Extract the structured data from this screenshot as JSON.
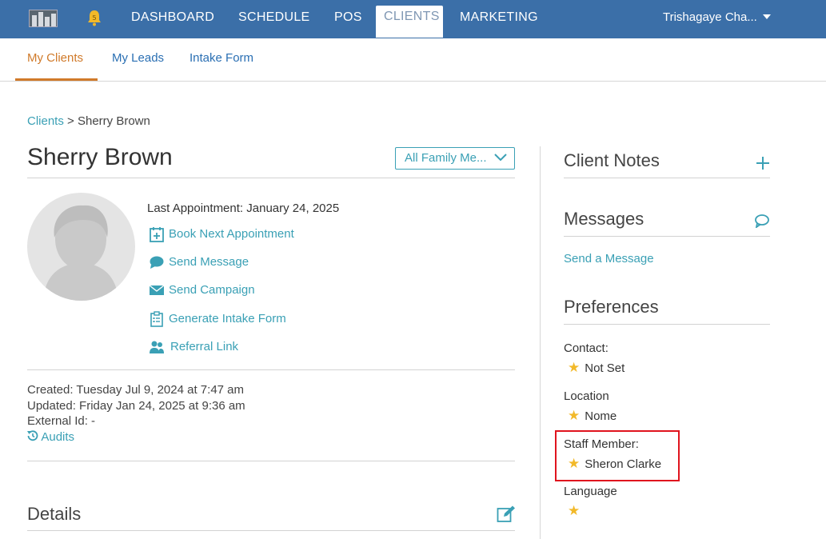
{
  "nav": {
    "notification_count": "5",
    "items": [
      "DASHBOARD",
      "SCHEDULE",
      "POS",
      "CLIENTS",
      "MARKETING"
    ],
    "user_name": "Trishagaye Cha..."
  },
  "subtabs": [
    "My Clients",
    "My Leads",
    "Intake Form"
  ],
  "breadcrumb": {
    "root": "Clients",
    "separator": ">",
    "current": "Sherry Brown"
  },
  "client": {
    "name": "Sherry Brown",
    "family_select": "All Family Me...",
    "last_appointment_label": "Last Appointment:",
    "last_appointment_value": "January 24, 2025",
    "actions": [
      "Book Next Appointment",
      "Send Message",
      "Send Campaign",
      "Generate Intake Form",
      "Referral Link"
    ],
    "created": "Created: Tuesday Jul 9, 2024 at 7:47 am",
    "updated": "Updated: Friday Jan 24, 2025 at 9:36 am",
    "external_id": "External Id: -",
    "audits": "Audits",
    "details_title": "Details"
  },
  "sidebar": {
    "client_notes_title": "Client Notes",
    "messages_title": "Messages",
    "send_message_link": "Send a Message",
    "preferences_title": "Preferences",
    "preferences": [
      {
        "label": "Contact:",
        "value": "Not Set"
      },
      {
        "label": "Location",
        "value": "Nome"
      },
      {
        "label": "Staff Member:",
        "value": "Sheron Clarke"
      },
      {
        "label": "Language",
        "value": ""
      }
    ]
  },
  "colors": {
    "topbar": "#3b6fa8",
    "link": "#3aa0b5",
    "accent": "#d07a2a",
    "star": "#f2b929",
    "highlight": "#e0141e"
  }
}
